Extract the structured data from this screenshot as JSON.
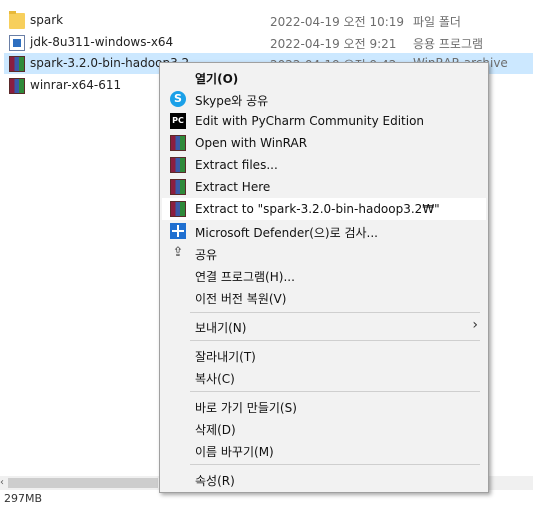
{
  "files": [
    {
      "name": "spark",
      "date": "2022-04-19 오전 10:19",
      "type": "파일 폴더",
      "icon": "folder-icon",
      "selected": false
    },
    {
      "name": "jdk-8u311-windows-x64",
      "date": "2022-04-19 오전 9:21",
      "type": "응용 프로그램",
      "icon": "java-installer-icon",
      "selected": false
    },
    {
      "name": "spark-3.2.0-bin-hadoop3.2",
      "date": "2022-04-19 오전 9:42",
      "type": "WinRAR archive",
      "icon": "winrar-archive-icon",
      "selected": true
    },
    {
      "name": "winrar-x64-611",
      "date": "",
      "type": "",
      "icon": "winrar-archive-icon",
      "selected": false
    }
  ],
  "status": {
    "text": "297MB"
  },
  "menu": {
    "items": [
      {
        "label": "열기(O)",
        "icon": "",
        "bold": true
      },
      {
        "label": "Skype와 공유",
        "icon": "skype-icon"
      },
      {
        "label": "Edit with PyCharm Community Edition",
        "icon": "pycharm-icon"
      },
      {
        "label": "Open with WinRAR",
        "icon": "winrar-icon"
      },
      {
        "label": "Extract files...",
        "icon": "winrar-icon"
      },
      {
        "label": "Extract Here",
        "icon": "winrar-icon"
      },
      {
        "label": "Extract to \"spark-3.2.0-bin-hadoop3.2₩\"",
        "icon": "winrar-icon",
        "highlighted": true
      },
      {
        "label": "Microsoft Defender(으)로 검사...",
        "icon": "defender-icon"
      },
      {
        "label": "공유",
        "icon": "share-icon"
      },
      {
        "label": "연결 프로그램(H)...",
        "icon": ""
      },
      {
        "label": "이전 버전 복원(V)",
        "icon": ""
      },
      {
        "label": "보내기(N)",
        "icon": "",
        "submenu": true
      },
      {
        "label": "잘라내기(T)",
        "icon": ""
      },
      {
        "label": "복사(C)",
        "icon": ""
      },
      {
        "label": "바로 가기 만들기(S)",
        "icon": ""
      },
      {
        "label": "삭제(D)",
        "icon": ""
      },
      {
        "label": "이름 바꾸기(M)",
        "icon": ""
      },
      {
        "label": "속성(R)",
        "icon": ""
      }
    ]
  }
}
